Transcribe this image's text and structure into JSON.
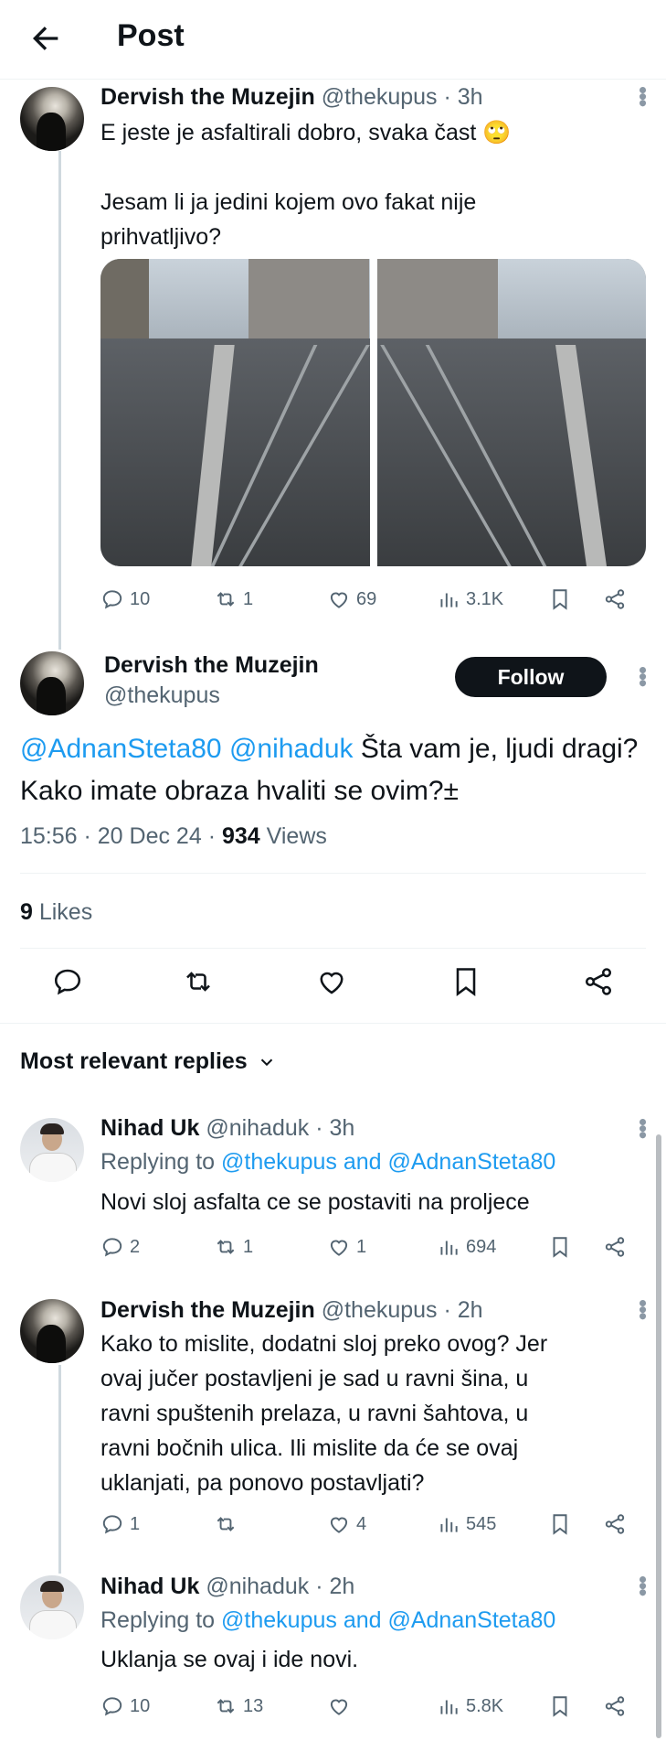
{
  "header": {
    "title": "Post"
  },
  "tweet_parent": {
    "name": "Dervish the Muzejin",
    "handle": "@thekupus · 3h",
    "text_line1": "E jeste je asfaltirali dobro, svaka čast 🙄",
    "text_line2": "Jesam li ja jedini kojem ovo fakat nije",
    "text_line3": "prihvatljivo?",
    "replies": "10",
    "reposts": "1",
    "likes": "69",
    "views": "3.1K"
  },
  "main_post": {
    "name": "Dervish the Muzejin",
    "handle": "@thekupus",
    "follow_label": "Follow",
    "mention1": "@AdnanSteta80",
    "mention2": "@nihaduk",
    "text_part1": " Šta vam je, ljudi",
    "text_part2": "dragi? Kako imate obraza hvaliti se ovim?±",
    "timestamp": "15:56 · 20 Dec 24 · ",
    "views_count": "934",
    "views_label": " Views",
    "likes_count": "9",
    "likes_label": " Likes"
  },
  "replies_sort": {
    "label": "Most relevant replies"
  },
  "replies": [
    {
      "name": "Nihad Uk",
      "handle": "@nihaduk · 3h",
      "replying_prefix": "Replying to ",
      "replying_to": "@thekupus and @AdnanSteta80",
      "text": "Novi sloj asfalta ce se postaviti na proljece",
      "replies": "2",
      "reposts": "1",
      "likes": "1",
      "views": "694"
    },
    {
      "name": "Dervish the Muzejin",
      "handle": "@thekupus · 2h",
      "text_lines": [
        "Kako to mislite, dodatni sloj preko ovog? Jer",
        "ovaj jučer postavljeni je sad u ravni šina, u",
        "ravni spuštenih prelaza, u ravni šahtova, u",
        "ravni bočnih ulica. Ili mislite da će se ovaj",
        "uklanjati, pa ponovo postavljati?"
      ],
      "replies": "1",
      "reposts": "",
      "likes": "4",
      "views": "545"
    },
    {
      "name": "Nihad Uk",
      "handle": "@nihaduk · 2h",
      "replying_prefix": "Replying to ",
      "replying_to": "@thekupus and @AdnanSteta80",
      "text": "Uklanja se ovaj i ide novi.",
      "replies": "10",
      "reposts": "13",
      "likes": "",
      "views": "5.8K"
    }
  ],
  "colors": {
    "link": "#1d9bf0",
    "muted": "#536471",
    "text": "#0f1419",
    "divider": "#eff3f4"
  },
  "icons": [
    "back-arrow-icon",
    "reply-icon",
    "repost-icon",
    "like-icon",
    "views-icon",
    "bookmark-icon",
    "share-icon",
    "more-icon",
    "chevron-down-icon"
  ]
}
